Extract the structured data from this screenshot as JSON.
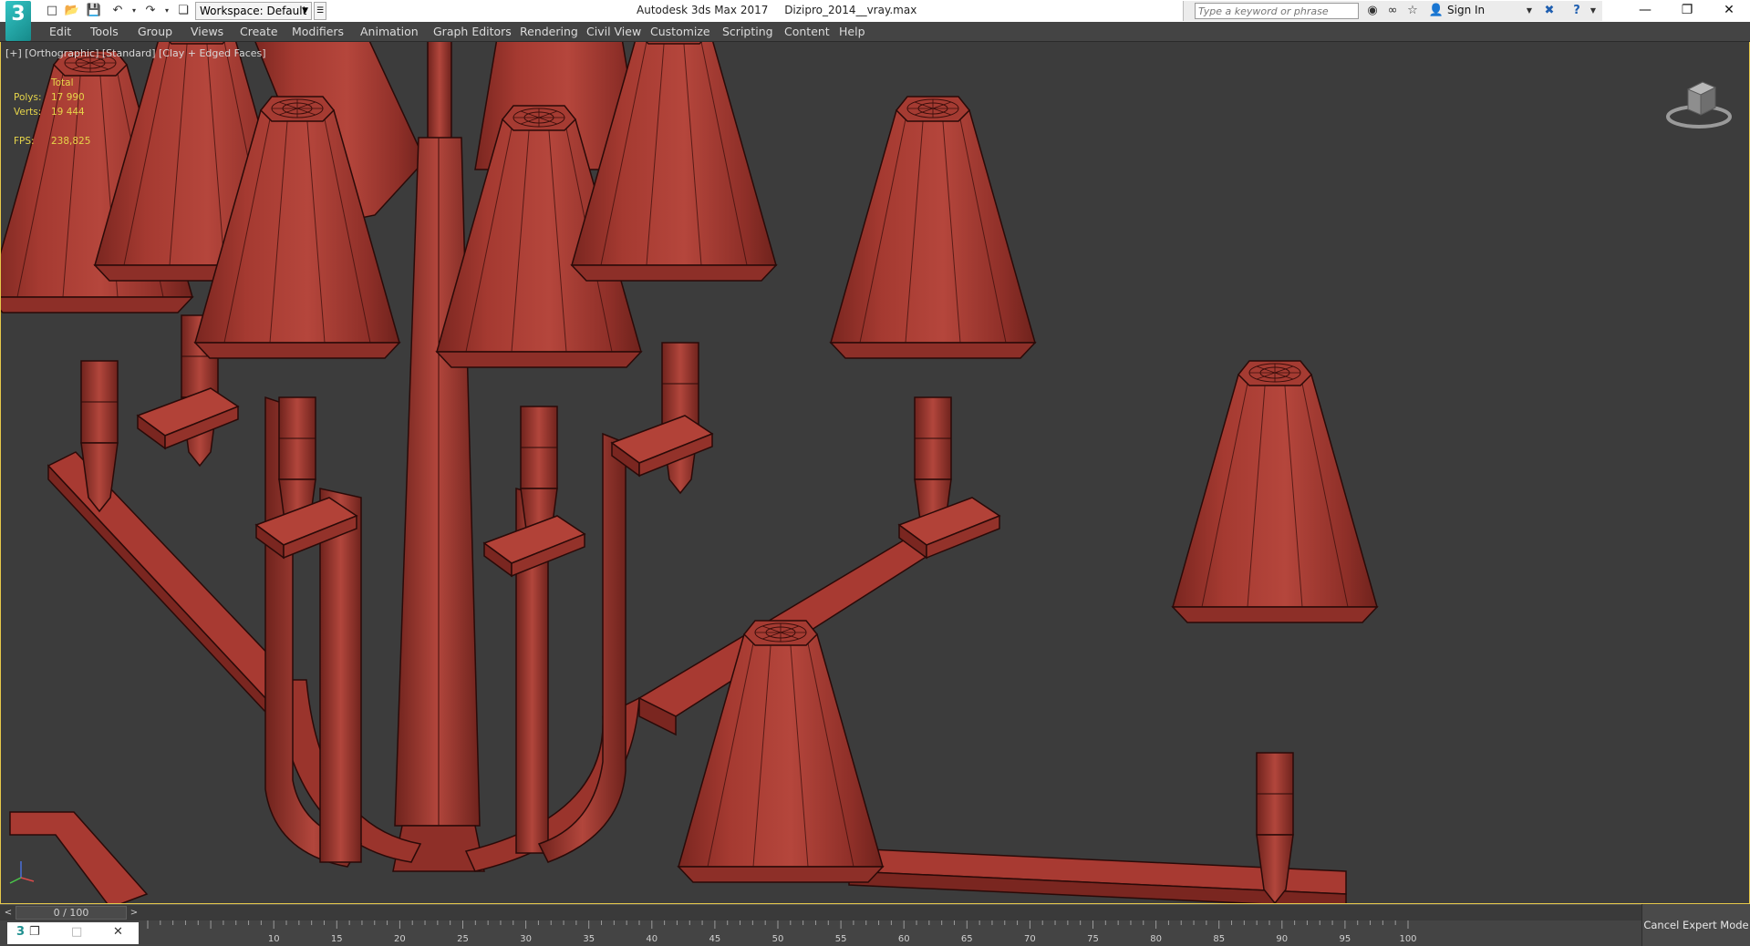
{
  "titlebar": {
    "workspace_label": "Workspace: Default",
    "app_name": "Autodesk 3ds Max 2017",
    "file_name": "Dizipro_2014__vray.max",
    "search_placeholder": "Type a keyword or phrase",
    "sign_in": "Sign In"
  },
  "menu": [
    "Edit",
    "Tools",
    "Group",
    "Views",
    "Create",
    "Modifiers",
    "Animation",
    "Graph Editors",
    "Rendering",
    "Civil View",
    "Customize",
    "Scripting",
    "Content",
    "Help"
  ],
  "viewport": {
    "label": "[+] [Orthographic] [Standard] [Clay + Edged Faces]",
    "stats": {
      "header": "Total",
      "polys_label": "Polys:",
      "polys_value": "17 990",
      "verts_label": "Verts:",
      "verts_value": "19 444",
      "fps_label": "FPS:",
      "fps_value": "238,825"
    }
  },
  "timeline": {
    "frame_display": "0 / 100",
    "ruler_labels": [
      "10",
      "15",
      "20",
      "25",
      "30",
      "35",
      "40",
      "45",
      "50",
      "55",
      "60",
      "65",
      "70",
      "75",
      "80",
      "85",
      "90",
      "95",
      "100"
    ]
  },
  "expert_mode_button": "Cancel Expert Mode",
  "colors": {
    "viewport_bg": "#3c3c3c",
    "model_clay": "#a83a32",
    "stats_text": "#e6d54a",
    "menubar_bg": "#444444"
  }
}
